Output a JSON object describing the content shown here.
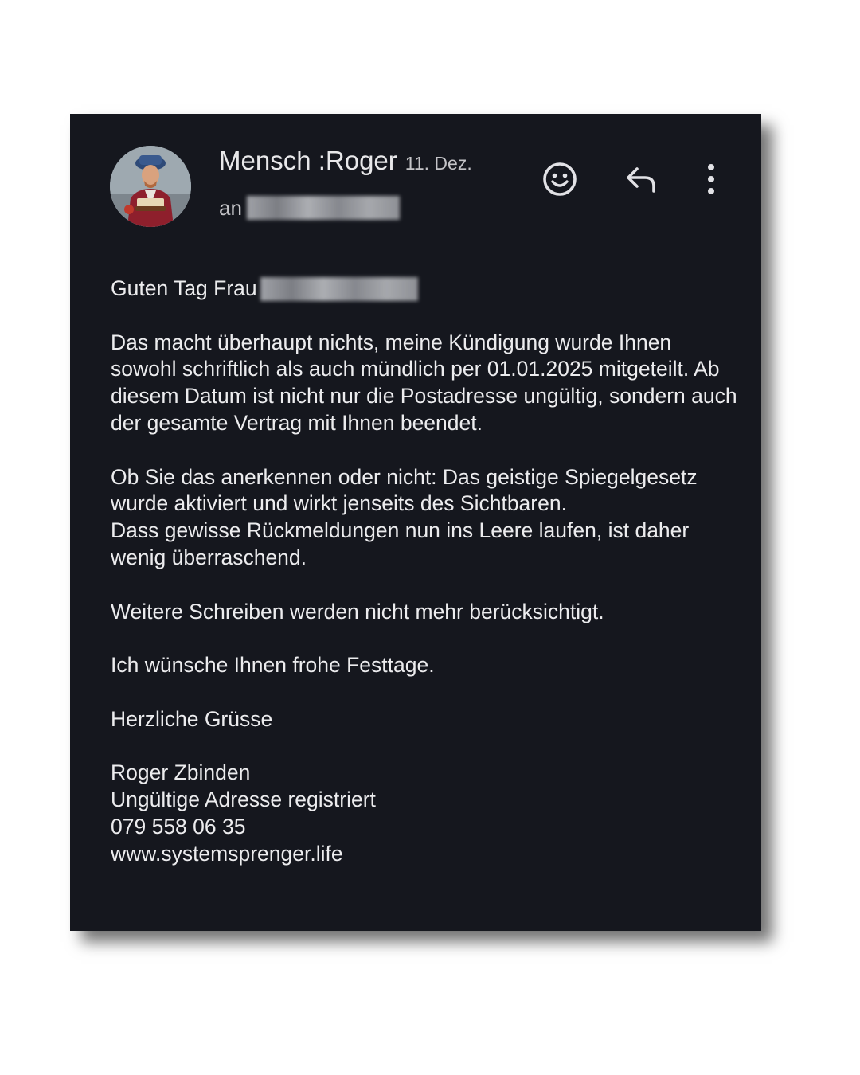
{
  "email": {
    "sender_name": "Mensch :Roger",
    "date": "11. Dez.",
    "recipient_prefix": "an"
  },
  "toolbar": {
    "emoji_icon": "emoji-smile-icon",
    "reply_icon": "reply-icon",
    "more_icon": "more-vertical-icon"
  },
  "body": {
    "greeting": "Guten Tag Frau",
    "paragraph1": "Das macht überhaupt nichts, meine Kündigung wurde Ihnen sowohl schriftlich als auch mündlich per 01.01.2025 mitgeteilt. Ab diesem Datum ist nicht nur die Postadresse ungültig, sondern auch der gesamte Vertrag mit Ihnen beendet.",
    "paragraph2_line1": "Ob Sie das anerkennen oder nicht: Das geistige Spiegelgesetz wurde aktiviert und wirkt jenseits des Sichtbaren.",
    "paragraph2_line2": "Dass gewisse Rückmeldungen nun ins Leere laufen, ist daher wenig überraschend.",
    "paragraph3": "Weitere Schreiben werden nicht mehr berücksichtigt.",
    "paragraph4": "Ich wünsche Ihnen frohe Festtage.",
    "closing": "Herzliche Grüsse"
  },
  "signature": {
    "name": "Roger Zbinden",
    "line2": "Ungültige Adresse registriert",
    "phone": "079 558 06 35",
    "website": "www.systemsprenger.life"
  },
  "colors": {
    "background": "#15171e",
    "text": "#ececee",
    "link": "#8ab4f8"
  }
}
